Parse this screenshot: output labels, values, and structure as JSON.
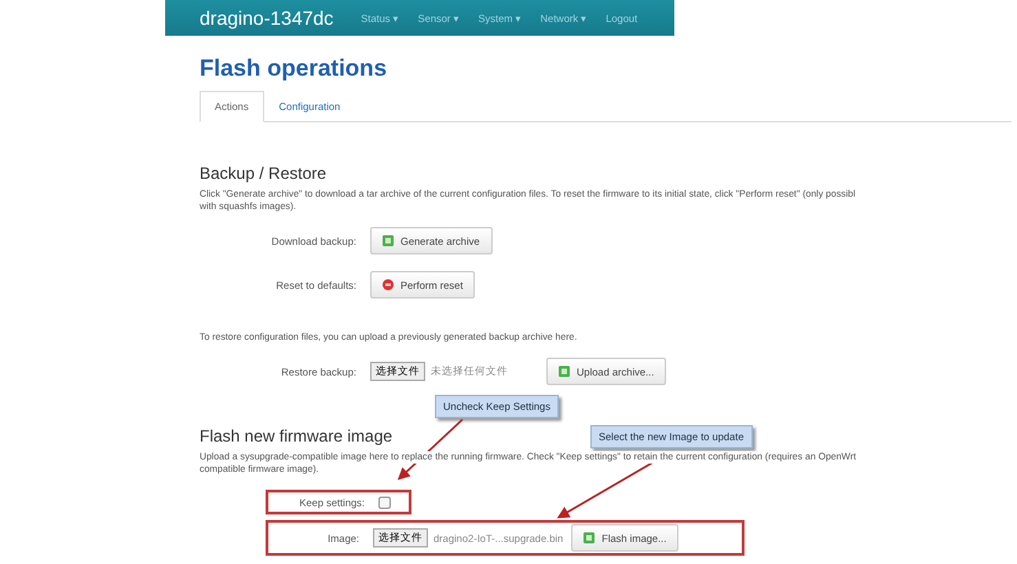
{
  "navbar": {
    "brand": "dragino-1347dc",
    "menu": [
      {
        "label": "Status ▾"
      },
      {
        "label": "Sensor ▾"
      },
      {
        "label": "System ▾"
      },
      {
        "label": "Network ▾"
      },
      {
        "label": "Logout"
      }
    ]
  },
  "page_title": "Flash operations",
  "tabs": [
    {
      "label": "Actions",
      "selected": true
    },
    {
      "label": "Configuration",
      "selected": false
    }
  ],
  "backup": {
    "heading": "Backup / Restore",
    "description": "Click \"Generate archive\" to download a tar archive of the current configuration files. To reset the firmware to its initial state, click \"Perform reset\" (only possibl",
    "description_2": "with squashfs images).",
    "rows": [
      {
        "label": "Download backup:",
        "button": "Generate archive",
        "kind": "archive"
      },
      {
        "label": "Reset to defaults:",
        "button": "Perform reset",
        "kind": "reset"
      }
    ],
    "restore_text": "To restore configuration files, you can upload a previously generated backup archive here.",
    "restore": {
      "label": "Restore backup:",
      "choose": "选择文件",
      "file": "未选择任何文件",
      "button": "Upload archive..."
    }
  },
  "flash": {
    "heading": "Flash new firmware image",
    "description": "Upload a sysupgrade-compatible image here to replace the running firmware. Check \"Keep settings\" to retain the current configuration (requires an OpenWrt",
    "description_2": "compatible firmware image).",
    "keep": {
      "label": "Keep settings:",
      "checked": false
    },
    "image": {
      "label": "Image:",
      "choose": "选择文件",
      "file": "dragino2-IoT-...supgrade.bin",
      "button": "Flash image..."
    }
  },
  "callouts": [
    {
      "text": "Uncheck Keep Settings"
    },
    {
      "text": "Select the new Image to update"
    }
  ]
}
